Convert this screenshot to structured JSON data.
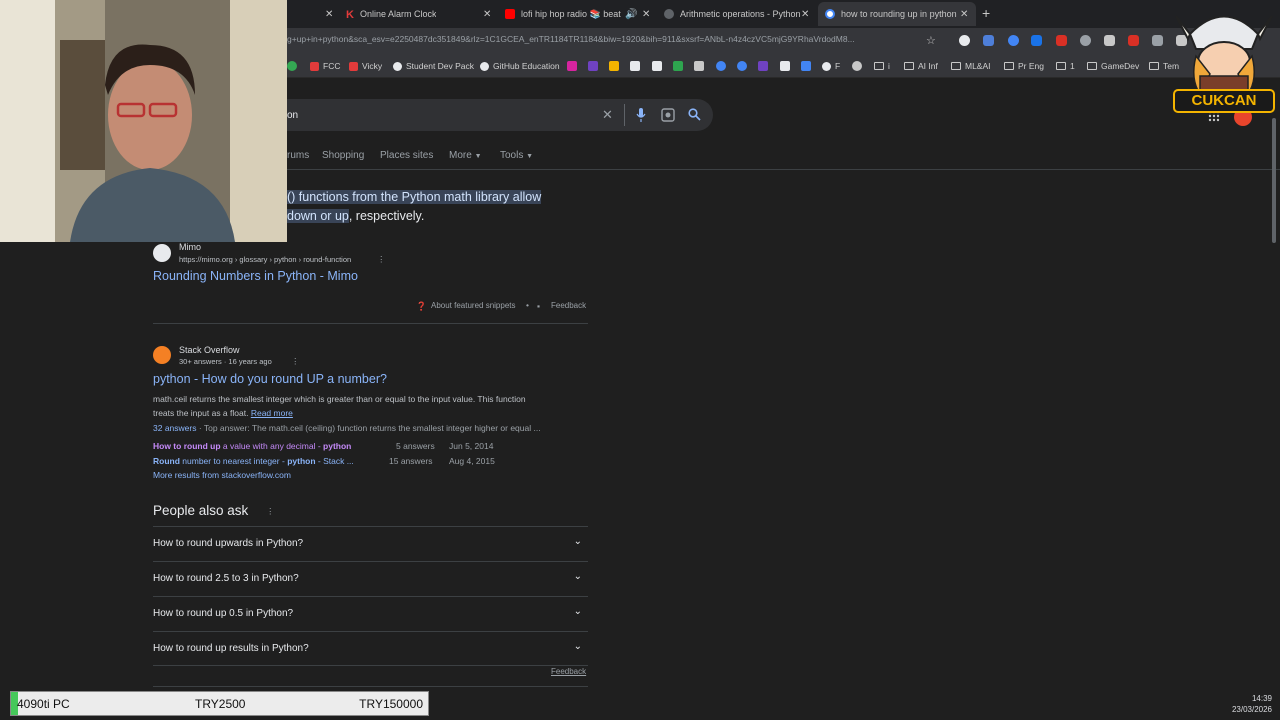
{
  "browser": {
    "tabs": [
      {
        "label": "",
        "favicon_color": "#5f6368"
      },
      {
        "label": "Online Alarm Clock",
        "favicon_color": "#e23b3b"
      },
      {
        "label": "lofi hip hop radio 📚 beats",
        "favicon_color": "#ff0000"
      },
      {
        "label": "Arithmetic operations - Python",
        "favicon_color": "#5f6368"
      },
      {
        "label": "how to rounding up in python",
        "favicon_color": "#4285f4"
      }
    ],
    "new_tab_label": "+",
    "url": "g+up+in+python&sca_esv=e2250487dc351849&rlz=1C1GCEA_enTR1184TR1184&biw=1920&bih=911&sxsrf=ANbL-n4z4czVC5mjG9YRhaVrdodM8...",
    "bookmarks": [
      {
        "label": "FCC",
        "icon": "fcc-icon"
      },
      {
        "label": "Vicky",
        "icon": "vicky-icon"
      },
      {
        "label": "Student Dev Pack",
        "icon": "github-icon"
      },
      {
        "label": "GitHub Education",
        "icon": "github-icon"
      },
      {
        "label": "F",
        "icon": "globe-icon"
      },
      {
        "label": "i",
        "icon": "folder-icon"
      },
      {
        "label": "AI Inf",
        "icon": "folder-icon"
      },
      {
        "label": "ML&AI",
        "icon": "folder-icon"
      },
      {
        "label": "Pr Eng",
        "icon": "folder-icon"
      },
      {
        "label": "1",
        "icon": "folder-icon"
      },
      {
        "label": "GameDev",
        "icon": "folder-icon"
      },
      {
        "label": "Tem",
        "icon": "folder-icon"
      }
    ]
  },
  "search": {
    "query_visible": "on",
    "tabs": [
      "rums",
      "Shopping",
      "Places sites",
      "More",
      "Tools"
    ]
  },
  "featured": {
    "line1_hl": "() functions from the Python math library allow",
    "line2_hl": "down or up",
    "line2_rest": ", respectively.",
    "source_name": "Mimo",
    "source_url": "https://mimo.org › glossary › python › round-function",
    "title": "Rounding Numbers in Python - Mimo",
    "about": "About featured snippets",
    "feedback": "Feedback"
  },
  "result": {
    "source_name": "Stack Overflow",
    "source_meta": "30+ answers · 16 years ago",
    "title": "python - How do you round UP a number?",
    "body1": "math.ceil returns the smallest integer which is greater than or equal to the input value. This function",
    "body2": "treats the input as a float.",
    "read_more": "Read more",
    "answers_count": "32 answers",
    "top_answer": " · Top answer: The math.ceil (ceiling) function returns the smallest integer higher or equal ...",
    "sub1_a": "How to round up",
    "sub1_b": " a value with any decimal - ",
    "sub1_c": "python",
    "sub1_meta1": "5 answers",
    "sub1_meta2": "Jun 5, 2014",
    "sub2_a": "Round",
    "sub2_b": " number to nearest integer - ",
    "sub2_c": "python",
    "sub2_d": " - Stack ...",
    "sub2_meta1": "15 answers",
    "sub2_meta2": "Aug 4, 2015",
    "more": "More results from stackoverflow.com"
  },
  "paa": {
    "title": "People also ask",
    "questions": [
      "How to round upwards in Python?",
      "How to round 2.5 to 3 in Python?",
      "How to round up 0.5 in Python?",
      "How to round up results in Python?"
    ],
    "feedback": "Feedback"
  },
  "overlay": {
    "mascot_text": "CUKCAN",
    "goal_label": "4090ti PC",
    "goal_current": "TRY2500",
    "goal_target": "TRY150000",
    "goal_progress": 0.017
  },
  "clock": {
    "time": "14:39",
    "date": "23/03/2026"
  }
}
